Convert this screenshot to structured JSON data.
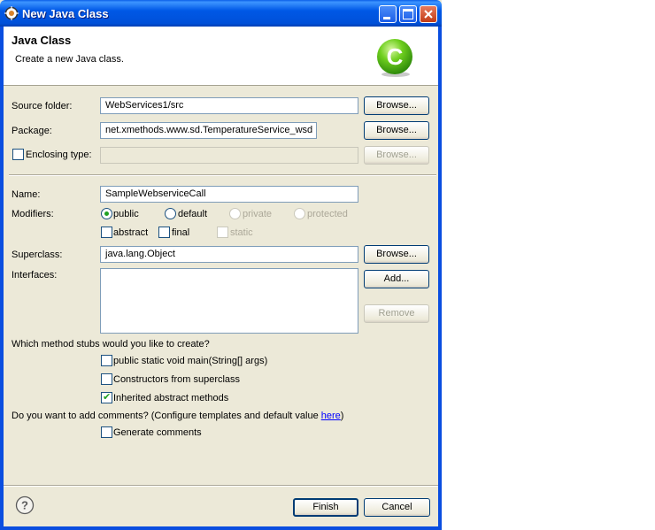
{
  "window": {
    "title": "New Java Class"
  },
  "header": {
    "title": "Java Class",
    "subtitle": "Create a new Java class.",
    "logo_letter": "C"
  },
  "source_folder": {
    "label": "Source folder:",
    "value": "WebServices1/src",
    "browse": "Browse..."
  },
  "package": {
    "label": "Package:",
    "value": "net.xmethods.www.sd.TemperatureService_wsd",
    "browse": "Browse..."
  },
  "enclosing": {
    "label": "Enclosing type:",
    "value": "",
    "browse": "Browse...",
    "checked": false
  },
  "name": {
    "label": "Name:",
    "value": "SampleWebserviceCall"
  },
  "modifiers": {
    "label": "Modifiers:",
    "public": "public",
    "default": "default",
    "private": "private",
    "protected": "protected",
    "abstract": "abstract",
    "final": "final",
    "static": "static",
    "selected": "public"
  },
  "superclass": {
    "label": "Superclass:",
    "value": "java.lang.Object",
    "browse": "Browse..."
  },
  "interfaces": {
    "label": "Interfaces:",
    "add": "Add...",
    "remove": "Remove"
  },
  "stubs": {
    "question": "Which method stubs would you like to create?",
    "main": "public static void main(String[] args)",
    "constructors": "Constructors from superclass",
    "inherited": "Inherited abstract methods",
    "inherited_checked": true
  },
  "comments": {
    "question_prefix": "Do you want to add comments? (Configure templates and default value ",
    "link": "here",
    "question_suffix": ")",
    "generate": "Generate comments"
  },
  "footer": {
    "help": "?",
    "finish": "Finish",
    "cancel": "Cancel"
  },
  "colors": {
    "titlebar": "#0058e6",
    "dialog_bg": "#ece9d8",
    "check_green": "#21a121"
  }
}
